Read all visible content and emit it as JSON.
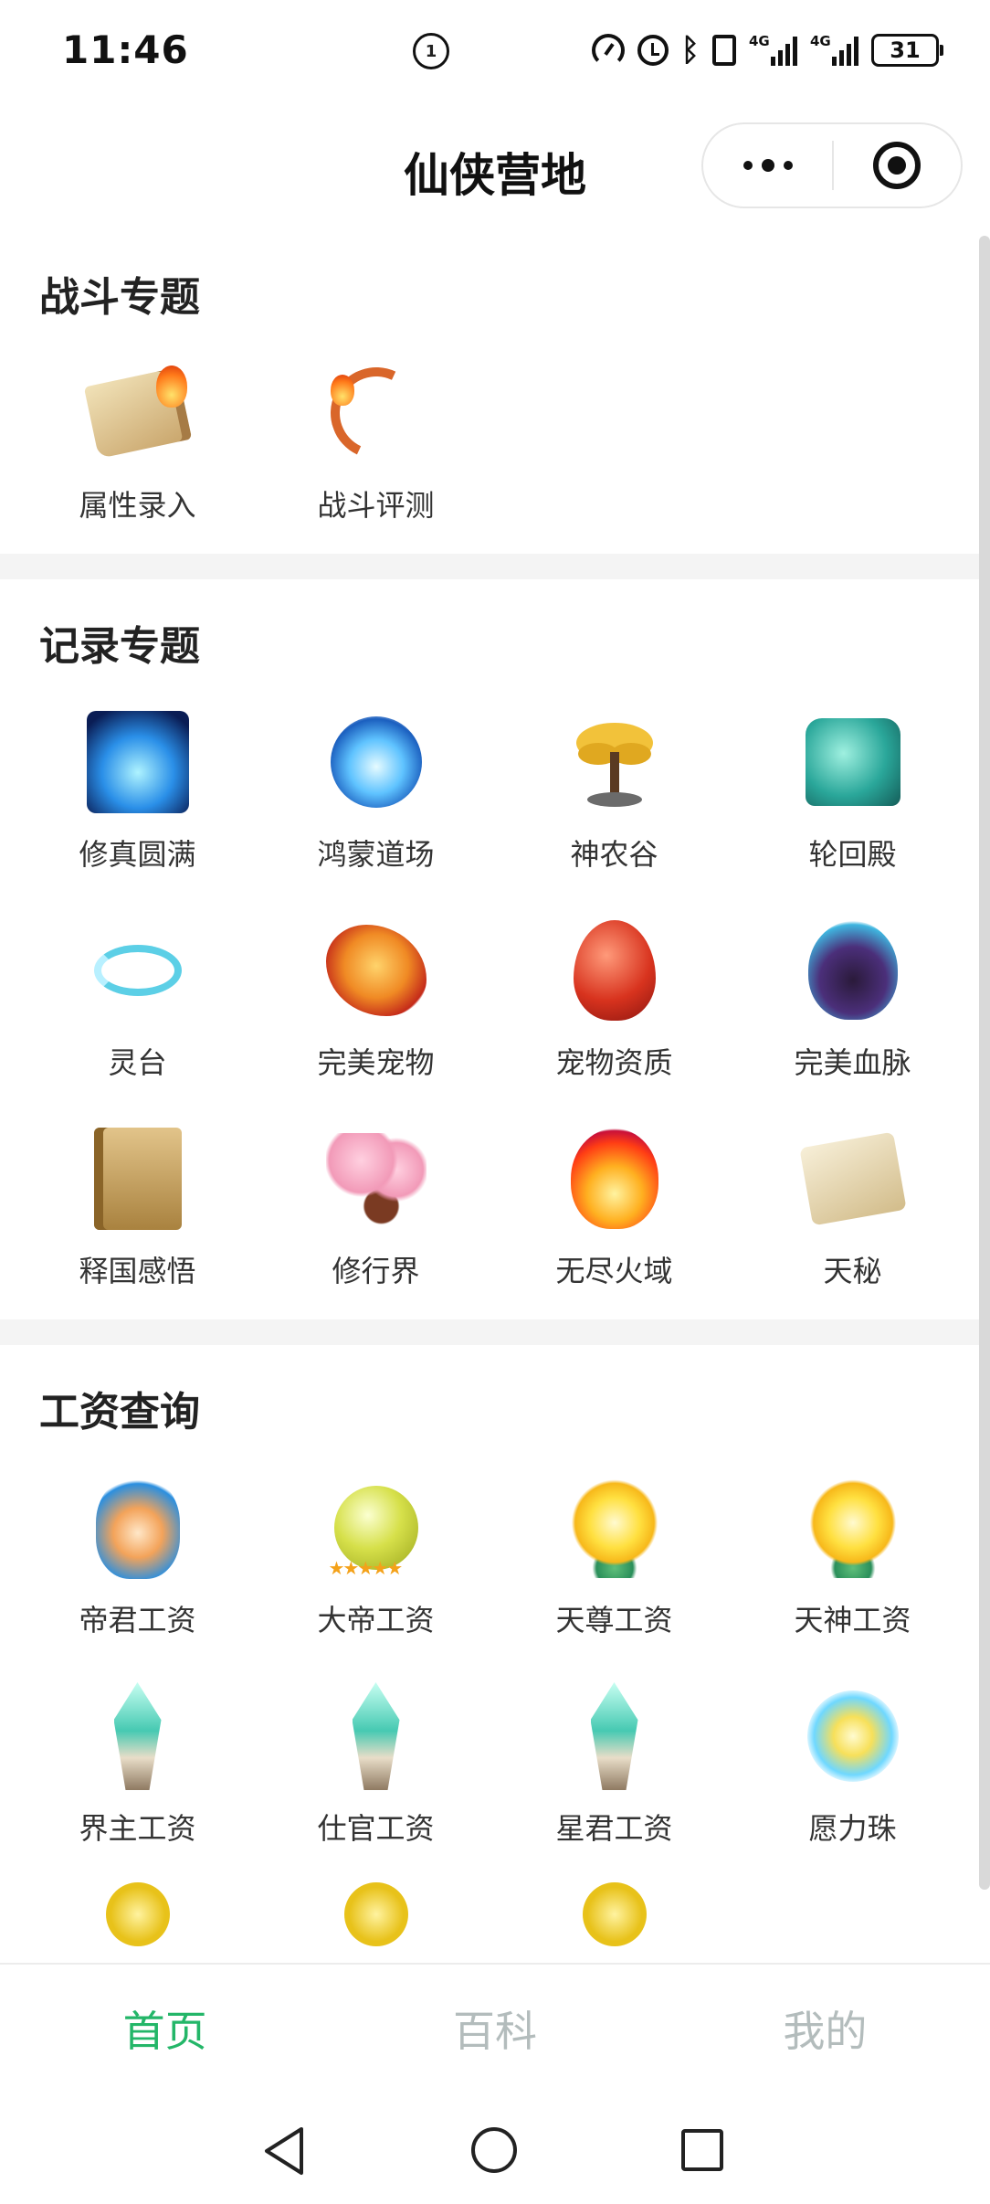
{
  "status_bar": {
    "time": "11:46",
    "center_badge": "1",
    "network_1": "4G",
    "network_2": "4G",
    "battery": "31",
    "icons": [
      "data-saver-icon",
      "speed-icon",
      "alarm-icon",
      "bluetooth-icon",
      "vibrate-icon",
      "signal-icon",
      "signal-icon",
      "battery-icon"
    ]
  },
  "header": {
    "title": "仙侠营地",
    "capsule_icons": [
      "more-icon",
      "close-miniprogram-icon"
    ]
  },
  "sections": [
    {
      "title": "战斗专题",
      "items": [
        {
          "label": "属性录入",
          "icon": "attribute-book-icon"
        },
        {
          "label": "战斗评测",
          "icon": "bow-icon"
        }
      ]
    },
    {
      "title": "记录专题",
      "items": [
        {
          "label": "修真圆满",
          "icon": "cultivation-icon"
        },
        {
          "label": "鸿蒙道场",
          "icon": "blue-orb-icon"
        },
        {
          "label": "神农谷",
          "icon": "golden-tree-icon"
        },
        {
          "label": "轮回殿",
          "icon": "jade-seal-icon"
        },
        {
          "label": "灵台",
          "icon": "spirit-swirl-icon"
        },
        {
          "label": "完美宠物",
          "icon": "phoenix-icon"
        },
        {
          "label": "宠物资质",
          "icon": "pet-egg-icon"
        },
        {
          "label": "完美血脉",
          "icon": "bloodline-icon"
        },
        {
          "label": "释国感悟",
          "icon": "tome-icon"
        },
        {
          "label": "修行界",
          "icon": "blossom-tree-icon"
        },
        {
          "label": "无尽火域",
          "icon": "fire-icon"
        },
        {
          "label": "天秘",
          "icon": "scroll-icon"
        }
      ]
    },
    {
      "title": "工资查询",
      "items": [
        {
          "label": "帝君工资",
          "icon": "vase-icon"
        },
        {
          "label": "大帝工资",
          "icon": "pearl-stars-icon"
        },
        {
          "label": "天尊工资",
          "icon": "gold-flame-icon"
        },
        {
          "label": "天神工资",
          "icon": "gold-flame-icon"
        },
        {
          "label": "界主工资",
          "icon": "gem-icon"
        },
        {
          "label": "仕官工资",
          "icon": "gem-icon"
        },
        {
          "label": "星君工资",
          "icon": "gem-icon"
        },
        {
          "label": "愿力珠",
          "icon": "wish-orb-icon"
        }
      ]
    }
  ],
  "tabs": [
    {
      "label": "首页",
      "active": true
    },
    {
      "label": "百科",
      "active": false
    },
    {
      "label": "我的",
      "active": false
    }
  ],
  "colors": {
    "accent": "#23b668",
    "tab_inactive": "#b3bcbc",
    "section_gap": "#f4f4f4"
  }
}
